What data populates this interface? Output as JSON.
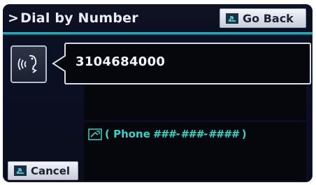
{
  "header": {
    "prefix": ">",
    "title": "Dial by Number",
    "go_back_label": "Go Back"
  },
  "display": {
    "entered_number": "3104684000"
  },
  "hint": {
    "open": "( Phone",
    "pattern": "###-###-####",
    "close": ")"
  },
  "footer": {
    "cancel_label": "Cancel"
  },
  "icons": {
    "voice": "voice-command-icon",
    "go_back": "return-arrow-icon",
    "cancel": "return-arrow-icon",
    "hint": "talk-icon"
  },
  "colors": {
    "accent": "#2fa7b6",
    "hint_text": "#3fd1c4",
    "background": "#0b0f22",
    "button_face": "#e2e6ee"
  }
}
